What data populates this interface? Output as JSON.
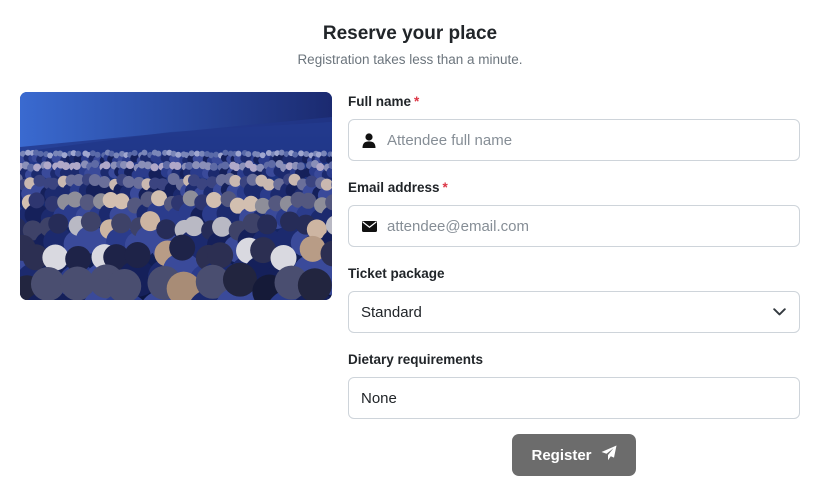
{
  "header": {
    "title": "Reserve your place",
    "subtitle": "Registration takes less than a minute."
  },
  "photo": {
    "icon": "audience-photo"
  },
  "form": {
    "full_name": {
      "label": "Full name",
      "required_mark": "*",
      "placeholder": "Attendee full name",
      "icon": "user-icon"
    },
    "email": {
      "label": "Email address",
      "required_mark": "*",
      "placeholder": "attendee@email.com",
      "icon": "envelope-icon"
    },
    "ticket": {
      "label": "Ticket package",
      "selected": "Standard",
      "icon": "chevron-down-icon"
    },
    "dietary": {
      "label": "Dietary requirements",
      "value": "None"
    }
  },
  "submit": {
    "label": "Register",
    "icon": "paper-plane-icon"
  },
  "colors": {
    "button_bg": "#6c6c6c",
    "required": "#dc3545",
    "border": "#ced4da"
  }
}
